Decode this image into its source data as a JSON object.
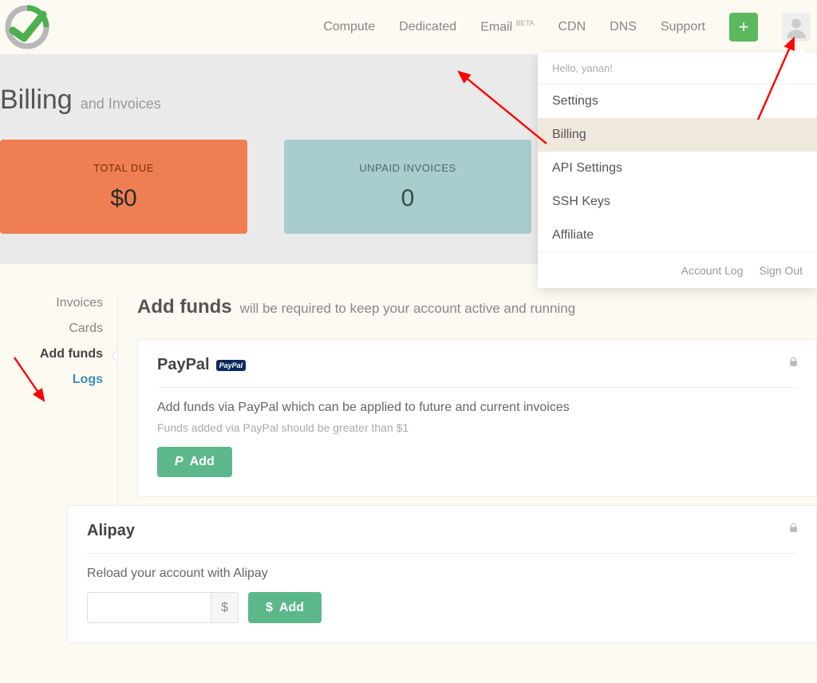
{
  "nav": {
    "compute": "Compute",
    "dedicated": "Dedicated",
    "email": "Email",
    "email_badge": "BETA",
    "cdn": "CDN",
    "dns": "DNS",
    "support": "Support"
  },
  "dropdown": {
    "hello": "Hello, yanan!",
    "settings": "Settings",
    "billing": "Billing",
    "api": "API Settings",
    "ssh": "SSH Keys",
    "affiliate": "Affiliate",
    "account_log": "Account Log",
    "sign_out": "Sign Out"
  },
  "banner": {
    "title": "Billing",
    "subtitle": "and Invoices",
    "total_due_label": "TOTAL DUE",
    "total_due_value": "$0",
    "unpaid_label": "UNPAID INVOICES",
    "unpaid_value": "0"
  },
  "sidebar": {
    "invoices": "Invoices",
    "cards": "Cards",
    "add_funds": "Add funds",
    "logs": "Logs"
  },
  "content": {
    "title": "Add funds",
    "subtitle": "will be required to keep your account active and running"
  },
  "paypal": {
    "heading": "PayPal",
    "badge": "PayPal",
    "desc": "Add funds via PayPal which can be applied to future and current invoices",
    "note": "Funds added via PayPal should be greater than $1",
    "button": "Add"
  },
  "alipay": {
    "heading": "Alipay",
    "desc": "Reload your account with Alipay",
    "currency": "$",
    "button": "Add"
  }
}
